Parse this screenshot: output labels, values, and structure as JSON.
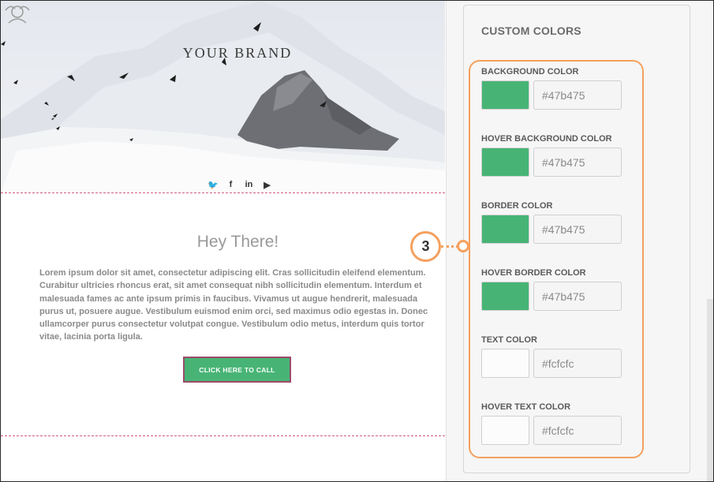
{
  "preview": {
    "brand_name": "YOUR BRAND",
    "social_icons": [
      "twitter-icon",
      "facebook-icon",
      "linkedin-icon",
      "youtube-icon"
    ],
    "social_glyphs": {
      "twitter": "🐦",
      "facebook": "f",
      "linkedin": "in",
      "youtube": "▶"
    },
    "greeting": "Hey There!",
    "body": "Lorem ipsum dolor sit amet, consectetur adipiscing elit. Cras sollicitudin eleifend elementum. Curabitur ultricies rhoncus erat, sit amet consequat nibh sollicitudin elementum. Interdum et malesuada fames ac ante ipsum primis in faucibus. Vivamus ut augue hendrerit, malesuada purus ut, posuere augue. Vestibulum euismod enim orci, sed maximus odio egestas in. Donec ullamcorper purus consectetur volutpat congue. Vestibulum odio metus, interdum quis tortor vitae, lacinia porta ligula.",
    "cta_label": "CLICK HERE TO CALL",
    "cta_color": "#47b475"
  },
  "panel": {
    "title": "CUSTOM COLORS",
    "fields": [
      {
        "label": "BACKGROUND COLOR",
        "value": "#47b475",
        "swatch": "#47b475"
      },
      {
        "label": "HOVER BACKGROUND COLOR",
        "value": "#47b475",
        "swatch": "#47b475"
      },
      {
        "label": "BORDER COLOR",
        "value": "#47b475",
        "swatch": "#47b475"
      },
      {
        "label": "HOVER BORDER COLOR",
        "value": "#47b475",
        "swatch": "#47b475"
      },
      {
        "label": "TEXT COLOR",
        "value": "#fcfcfc",
        "swatch": "#fcfcfc"
      },
      {
        "label": "HOVER TEXT COLOR",
        "value": "#fcfcfc",
        "swatch": "#fcfcfc"
      }
    ]
  },
  "callout": {
    "number": "3",
    "color": "#f4a05e"
  }
}
